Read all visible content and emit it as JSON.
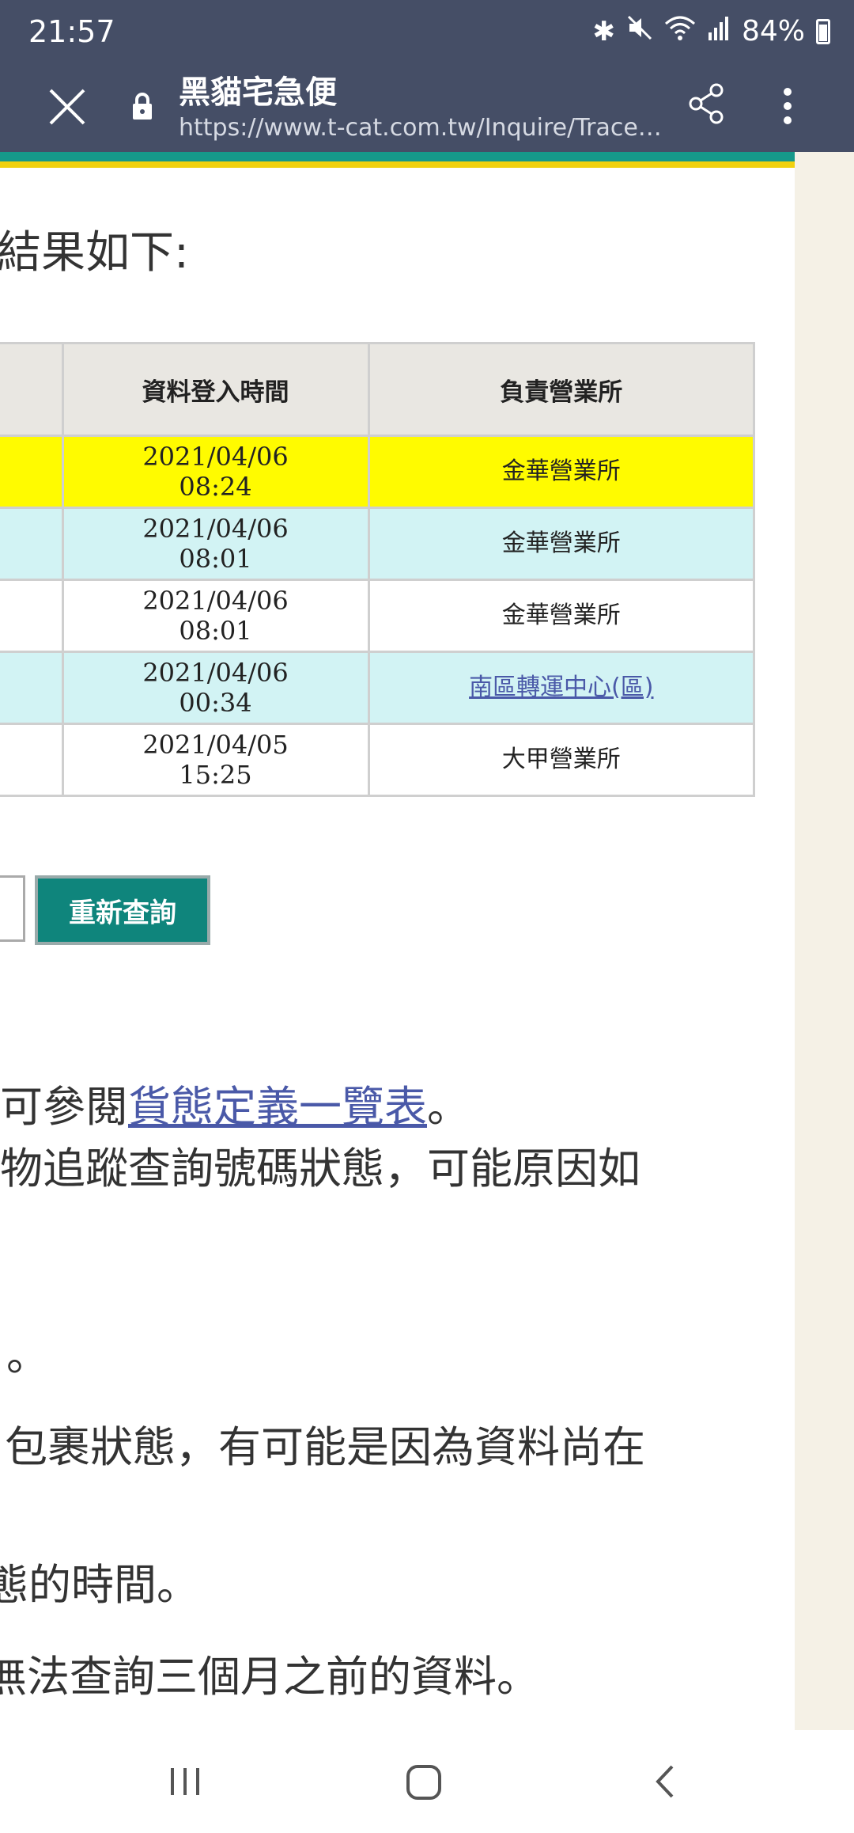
{
  "status_bar": {
    "time": "21:57",
    "battery": "84%",
    "icons": [
      "bluetooth-icon",
      "mute-icon",
      "wifi-icon",
      "signal-icon",
      "battery-icon"
    ]
  },
  "browser": {
    "title": "黑貓宅急便",
    "url": "https://www.t-cat.com.tw/Inquire/TraceDetail..."
  },
  "page": {
    "heading": "詢結果如下:",
    "table": {
      "headers": [
        "資料登入時間",
        "負責營業所"
      ],
      "rows": [
        {
          "date": "2021/04/06",
          "time": "08:24",
          "office": "金華營業所",
          "style": "yellow",
          "link": false
        },
        {
          "date": "2021/04/06",
          "time": "08:01",
          "office": "金華營業所",
          "style": "cyan",
          "link": false
        },
        {
          "date": "2021/04/06",
          "time": "08:01",
          "office": "金華營業所",
          "style": "white",
          "link": false
        },
        {
          "date": "2021/04/06",
          "time": "00:34",
          "office": "南區轉運中心(區)",
          "style": "cyan",
          "link": true
        },
        {
          "date": "2021/04/05",
          "time": "15:25",
          "office": "大甲營業所",
          "style": "white",
          "link": false
        }
      ]
    },
    "requery_button": "重新查詢",
    "notes": {
      "line1_prefix": "可參閱",
      "line1_link": "貨態定義一覽表",
      "line1_suffix": "。",
      "line2": "物追蹤查詢號碼狀態，可能原因如",
      "line3": "。",
      "line4": "包裹狀態，有可能是因為資料尚在",
      "line5": "態的時間。",
      "line6": "無法查詢三個月之前的資料。"
    }
  },
  "colors": {
    "toolbar": "#454e66",
    "stripe_green": "#16998a",
    "stripe_yellow": "#f1d10f",
    "row_yellow": "#fffb00",
    "row_cyan": "#d2f3f4",
    "button": "#0f857c"
  }
}
